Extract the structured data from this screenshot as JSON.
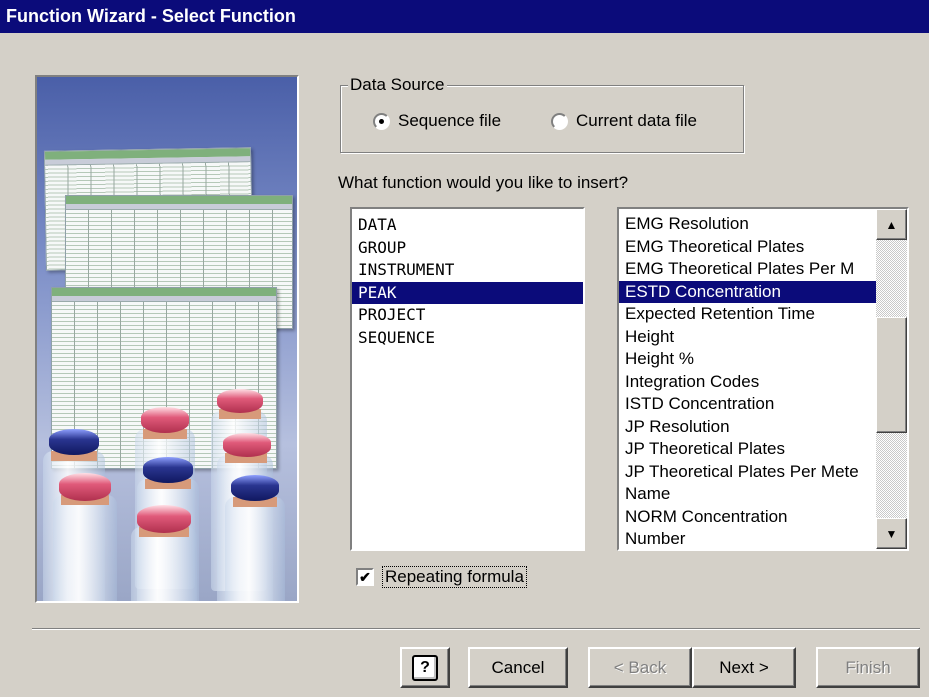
{
  "window": {
    "title": "Function Wizard - Select Function"
  },
  "data_source": {
    "legend": "Data Source",
    "options": [
      {
        "label": "Sequence file",
        "selected": true
      },
      {
        "label": "Current data file",
        "selected": false
      }
    ]
  },
  "question": "What function would you like to insert?",
  "categories": {
    "items": [
      "DATA",
      "GROUP",
      "INSTRUMENT",
      "PEAK",
      "PROJECT",
      "SEQUENCE"
    ],
    "selected": "PEAK"
  },
  "functions": {
    "items": [
      "EMG Resolution",
      "EMG Theoretical Plates",
      "EMG Theoretical Plates Per M",
      "ESTD Concentration",
      "Expected Retention Time",
      "Height",
      "Height %",
      "Integration Codes",
      "ISTD Concentration",
      "JP Resolution",
      "JP Theoretical Plates",
      "JP Theoretical Plates Per Mete",
      "Name",
      "NORM Concentration",
      "Number"
    ],
    "selected": "ESTD Concentration"
  },
  "repeating_formula": {
    "label": "Repeating formula",
    "checked": true
  },
  "buttons": {
    "help": "?",
    "cancel": "Cancel",
    "back": "< Back",
    "next": "Next >",
    "finish": "Finish"
  },
  "colors": {
    "titlebar": "#0b0b7a",
    "selection": "#0b0b7a",
    "dialog_bg": "#d4d0c8"
  },
  "icons": {
    "help": "help-question-icon",
    "scroll_up": "scroll-up-arrow-icon",
    "scroll_down": "scroll-down-arrow-icon",
    "checkmark": "checkmark-icon"
  }
}
